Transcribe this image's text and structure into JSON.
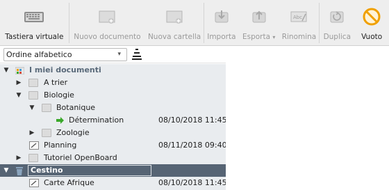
{
  "toolbar": {
    "buttons": [
      {
        "label": "Tastiera virtuale",
        "icon": "keyboard-icon",
        "enabled": true
      },
      {
        "label": "Nuovo documento",
        "icon": "new-document-icon",
        "enabled": false
      },
      {
        "label": "Nuova cartella",
        "icon": "new-folder-icon",
        "enabled": false
      },
      {
        "label": "Importa",
        "icon": "import-icon",
        "enabled": false
      },
      {
        "label": "Esporta",
        "icon": "export-icon",
        "enabled": false
      },
      {
        "label": "Rinomina",
        "icon": "rename-icon",
        "enabled": false
      },
      {
        "label": "Duplica",
        "icon": "duplicate-icon",
        "enabled": false
      },
      {
        "label": "Vuoto",
        "icon": "empty-trash-icon",
        "enabled": true
      }
    ]
  },
  "sort": {
    "selected": "Ordine alfabetico"
  },
  "tree": {
    "rows": [
      {
        "name": "I miei documenti",
        "date": ""
      },
      {
        "name": "A trier",
        "date": ""
      },
      {
        "name": "Biologie",
        "date": ""
      },
      {
        "name": "Botanique",
        "date": ""
      },
      {
        "name": "Détermination",
        "date": "08/10/2018 11:45"
      },
      {
        "name": "Zoologie",
        "date": ""
      },
      {
        "name": "Planning",
        "date": "08/11/2018 09:40"
      },
      {
        "name": "Tutoriel OpenBoard",
        "date": ""
      },
      {
        "name": "Cestino",
        "date": ""
      },
      {
        "name": "Carte Afrique",
        "date": "08/10/2018 11:45"
      }
    ]
  },
  "colors": {
    "toolbar_bg": "#eeeeee",
    "tree_bg": "#e9ecef",
    "selected_row": "#566474",
    "empty_icon": "#f0a000",
    "green_arrow": "#3aa82a"
  }
}
